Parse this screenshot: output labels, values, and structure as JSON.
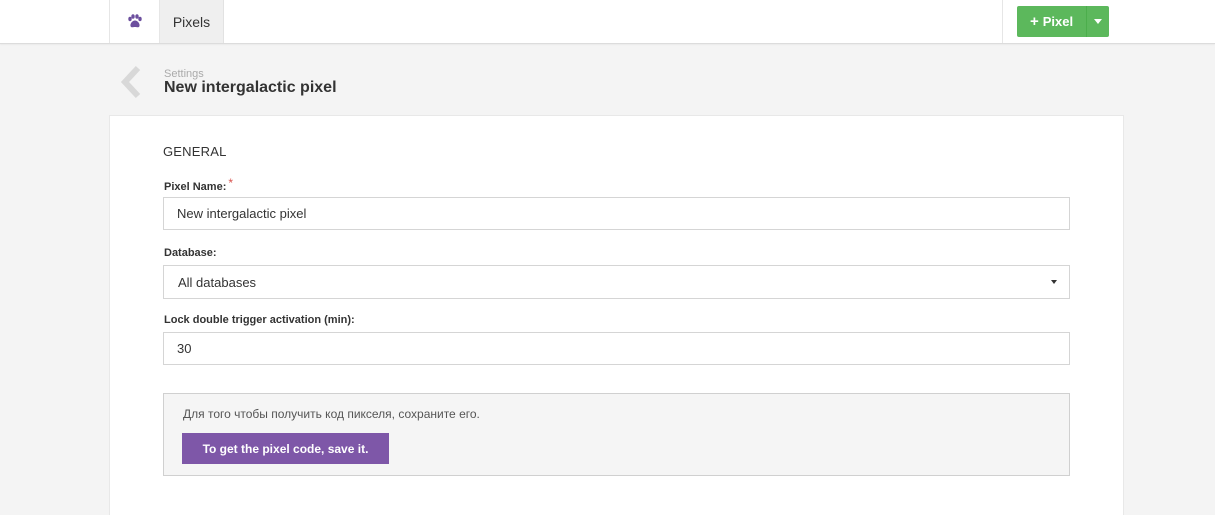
{
  "topbar": {
    "logo_icon": "paw-icon",
    "logo_color": "#6c4f9e",
    "tab_label": "Pixels",
    "add_button": {
      "plus": "+",
      "label": "Pixel",
      "color": "#5cb85c"
    }
  },
  "header": {
    "breadcrumb": "Settings",
    "title": "New intergalactic pixel"
  },
  "form": {
    "section_title": "GENERAL",
    "pixel_name": {
      "label": "Pixel Name:",
      "required_mark": "*",
      "value": "New intergalactic pixel"
    },
    "database": {
      "label": "Database:",
      "selected": "All databases"
    },
    "lock": {
      "label": "Lock double trigger activation (min):",
      "value": "30"
    }
  },
  "notice": {
    "text": "Для того чтобы получить код пикселя, сохраните его.",
    "button_label": "To get the pixel code, save it.",
    "button_color": "#7e57a8"
  }
}
